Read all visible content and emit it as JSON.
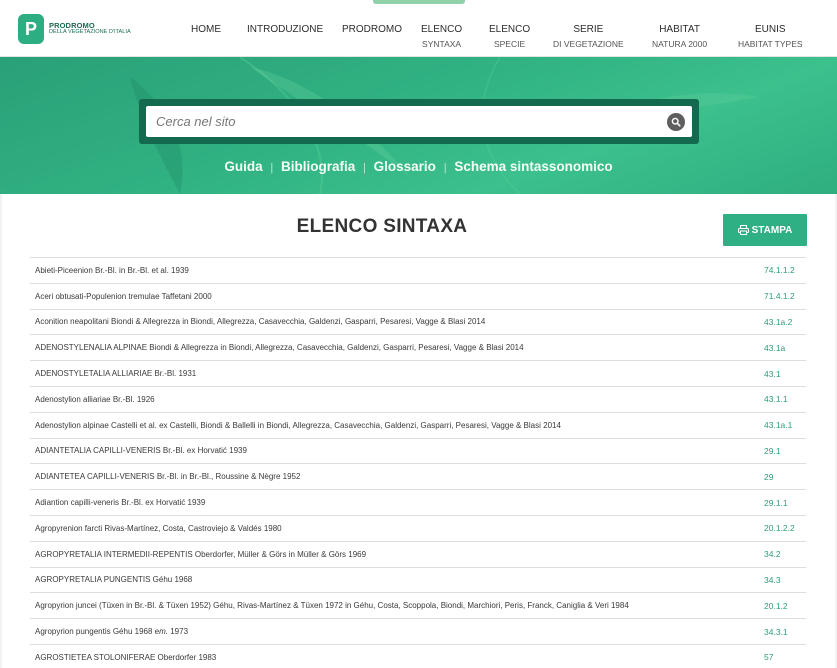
{
  "logo": {
    "letter": "P",
    "title": "PRODROMO",
    "subtitle": "DELLA VEGETAZIONE D'ITALIA"
  },
  "nav": [
    {
      "label": "HOME",
      "sub": ""
    },
    {
      "label": "INTRODUZIONE",
      "sub": ""
    },
    {
      "label": "PRODROMO",
      "sub": ""
    },
    {
      "label": "ELENCO",
      "sub": "SYNTAXA"
    },
    {
      "label": "ELENCO",
      "sub": "SPECIE"
    },
    {
      "label": "SERIE",
      "sub": "DI VEGETAZIONE"
    },
    {
      "label": "HABITAT",
      "sub": "NATURA 2000"
    },
    {
      "label": "EUNIS",
      "sub": "HABITAT TYPES"
    }
  ],
  "search": {
    "placeholder": "Cerca nel sito",
    "icon": "search-icon"
  },
  "hero_links": [
    "Guida",
    "Bibliografia",
    "Glossario",
    "Schema sintassonomico"
  ],
  "page": {
    "title": "ELENCO SINTAXA",
    "print_label": "STAMPA"
  },
  "colors": {
    "accent": "#2fb084",
    "dark_green": "#136a4f",
    "code_text": "#2a9f78"
  },
  "syntaxa": [
    {
      "name": "Abieti-Piceenion Br.-Bl. in Br.-Bl. et al. 1939",
      "code": "74.1.1.2"
    },
    {
      "name": "Aceri obtusati-Populenion tremulae Taffetani 2000",
      "code": "71.4.1.2"
    },
    {
      "name": "Aconition neapolitani Biondi & Allegrezza in Biondi, Allegrezza, Casavecchia, Galdenzi, Gasparri, Pesaresi, Vagge & Blasi 2014",
      "code": "43.1a.2"
    },
    {
      "name": "ADENOSTYLENALIA ALPINAE Biondi & Allegrezza in Biondi, Allegrezza, Casavecchia, Galdenzi, Gasparri, Pesaresi, Vagge & Blasi 2014",
      "code": "43.1a"
    },
    {
      "name": "ADENOSTYLETALIA ALLIARIAE Br.-Bl. 1931",
      "code": "43.1"
    },
    {
      "name": "Adenostylion alliariae Br.-Bl. 1926",
      "code": "43.1.1"
    },
    {
      "name": "Adenostylion alpinae Castelli et al. ex Castelli, Biondi & Ballelli in Biondi, Allegrezza, Casavecchia, Galdenzi, Gasparri, Pesaresi, Vagge & Blasi 2014",
      "code": "43.1a.1"
    },
    {
      "name": "ADIANTETALIA CAPILLI-VENERIS Br.-Bl. ex Horvatić 1939",
      "code": "29.1"
    },
    {
      "name": "ADIANTETEA CAPILLI-VENERIS Br.-Bl. in Br.-Bl., Roussine & Nègre 1952",
      "code": "29"
    },
    {
      "name": "Adiantion capilli-veneris Br.-Bl. ex Horvatić 1939",
      "code": "29.1.1"
    },
    {
      "name": "Agropyrenion farcti Rivas-Martínez, Costa, Castroviejo & Valdés 1980",
      "code": "20.1.2.2"
    },
    {
      "name": "AGROPYRETALIA INTERMEDII-REPENTIS Oberdorfer, Müller & Görs in Müller & Görs 1969",
      "code": "34.2"
    },
    {
      "name": "AGROPYRETALIA PUNGENTIS Géhu 1968",
      "code": "34.3"
    },
    {
      "name": "Agropyrion juncei (Tüxen in Br.-Bl. & Tüxen 1952) Géhu, Rivas-Martínez & Tüxen 1972 in Géhu, Costa, Scoppola, Biondi, Marchiori, Peris, Franck, Caniglia & Veri 1984",
      "code": "20.1.2"
    },
    {
      "name": "Agropyrion pungentis Géhu 1968",
      "emend": "em.",
      "name_tail": "1973",
      "code": "34.3.1"
    },
    {
      "name": "AGROSTIETEA STOLONIFERAE Oberdorfer 1983",
      "code": "57"
    }
  ]
}
